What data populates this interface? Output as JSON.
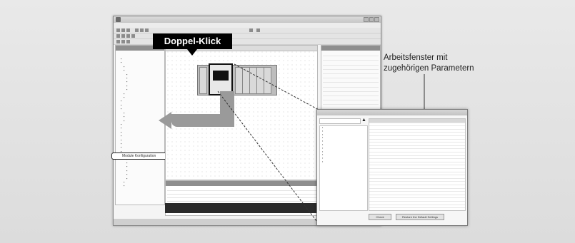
{
  "badge": {
    "label": "Doppel-Klick"
  },
  "callout": {
    "line1": "Arbeitsfenster mit",
    "line2": "zugehörigen Parametern"
  },
  "nav": {
    "selected_label": "Module Konfiguration"
  },
  "dialog": {
    "ok_label": "Check",
    "cancel_label": "Restore the Default Settings"
  }
}
